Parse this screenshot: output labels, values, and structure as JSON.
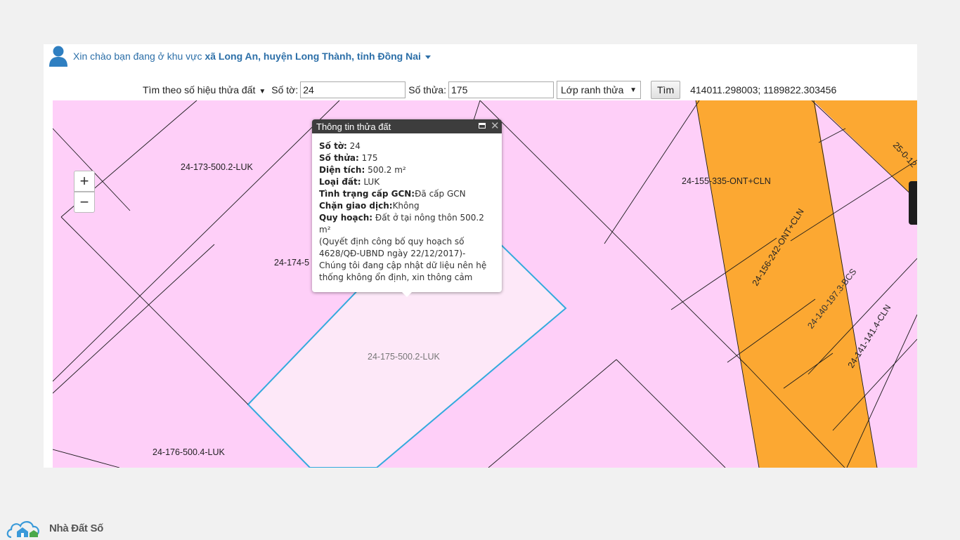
{
  "greeting": {
    "prefix": "Xin chào bạn đang ở khu vực ",
    "location": "xã Long An, huyện Long Thành, tỉnh Đồng Nai"
  },
  "search": {
    "mode_label": "Tìm theo số hiệu thửa đất",
    "sheet_label": "Số tờ:",
    "sheet_value": "24",
    "parcel_label": "Số thửa:",
    "parcel_value": "175",
    "layer_selected": "Lớp ranh thửa",
    "find_button": "Tìm",
    "coordinates": "414011.298003; 1189822.303456"
  },
  "map": {
    "zoom_in": "+",
    "zoom_out": "−",
    "colors": {
      "residential_agri": "#fecff8",
      "perennial": "#fca832",
      "selected_border": "#33aadd"
    },
    "labels": {
      "p173": "24-173-500.2-LUK",
      "p174": "24-174-5",
      "p175": "24-175-500.2-LUK",
      "p176": "24-176-500.4-LUK",
      "p155": "24-155-335-ONT+CLN",
      "p156": "24-156-242-ONT+CLN",
      "p140": "24-140-197.3-BCS",
      "p141": "24-141-141.4-CLN",
      "p25": "25-0-12"
    }
  },
  "popup": {
    "title": "Thông tin thửa đất",
    "sheet_k": "Số tờ:",
    "sheet_v": " 24",
    "parcel_k": "Số thửa:",
    "parcel_v": " 175",
    "area_k": "Diện tích:",
    "area_v": " 500.2 m²",
    "type_k": "Loại đất:",
    "type_v": " LUK",
    "gcn_k": "Tình trạng cấp GCN:",
    "gcn_v": "Đã cấp GCN",
    "block_k": "Chặn giao dịch:",
    "block_v": "Không",
    "plan_k": "Quy hoạch:",
    "plan_v": " Đất ở tại nông thôn 500.2 m²",
    "note": "(Quyết định công bố quy hoạch số 4628/QĐ-UBND ngày 22/12/2017)- Chúng tôi đang cập nhật dữ liệu nên hệ thống không ổn định, xin thông cảm"
  },
  "logo": {
    "brand": "Nhà Đất Số"
  }
}
